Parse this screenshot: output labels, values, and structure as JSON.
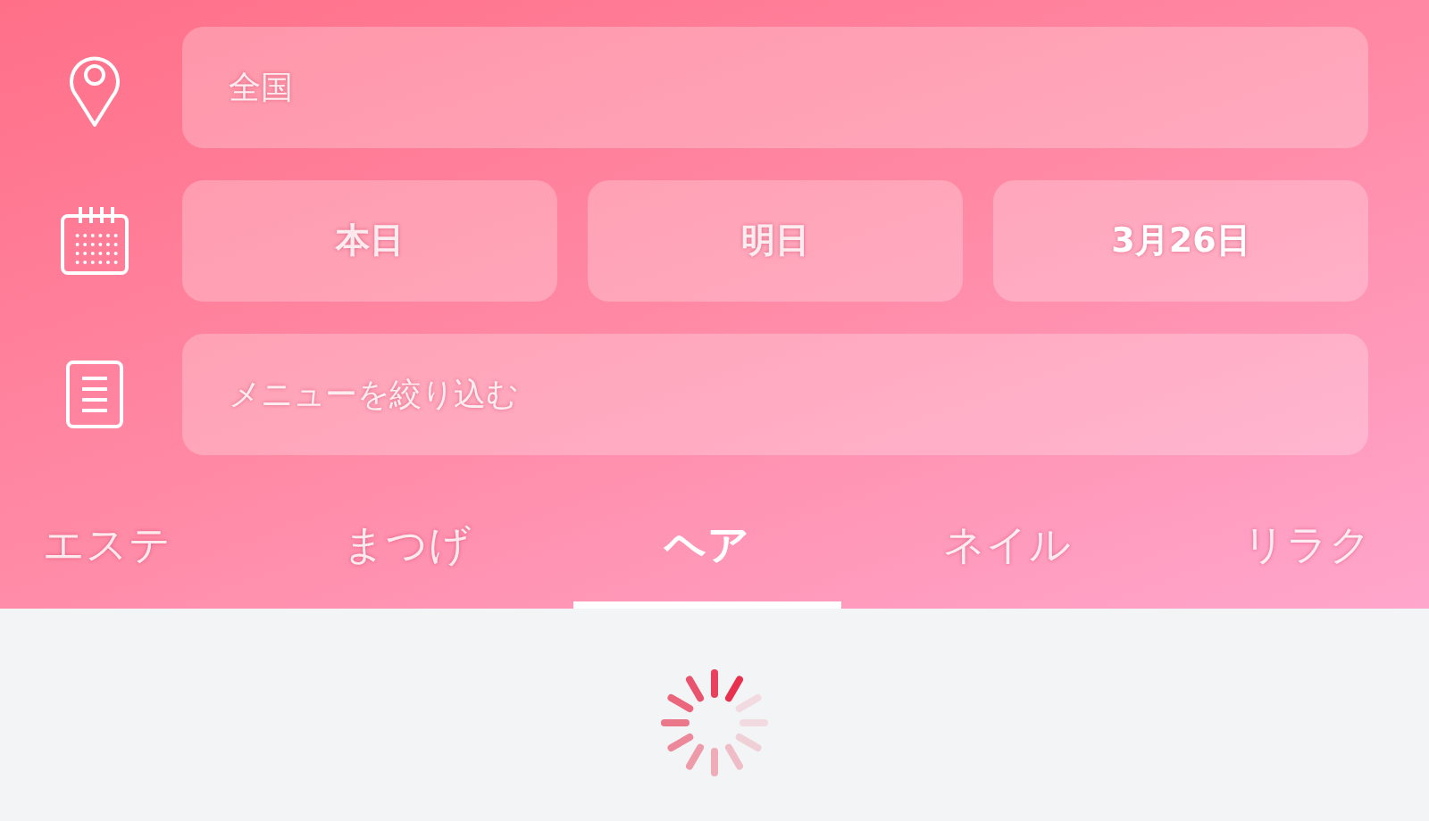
{
  "location": {
    "placeholder": "全国"
  },
  "dates": [
    {
      "label": "本日",
      "selected": false
    },
    {
      "label": "明日",
      "selected": false
    },
    {
      "label": "3月26日",
      "selected": true
    }
  ],
  "menu_filter": {
    "placeholder": "メニューを絞り込む"
  },
  "tabs": [
    {
      "label": "エステ",
      "selected": false
    },
    {
      "label": "まつげ",
      "selected": false
    },
    {
      "label": "ヘア",
      "selected": true
    },
    {
      "label": "ネイル",
      "selected": false
    },
    {
      "label": "リラク",
      "selected": false
    }
  ],
  "loading": true
}
